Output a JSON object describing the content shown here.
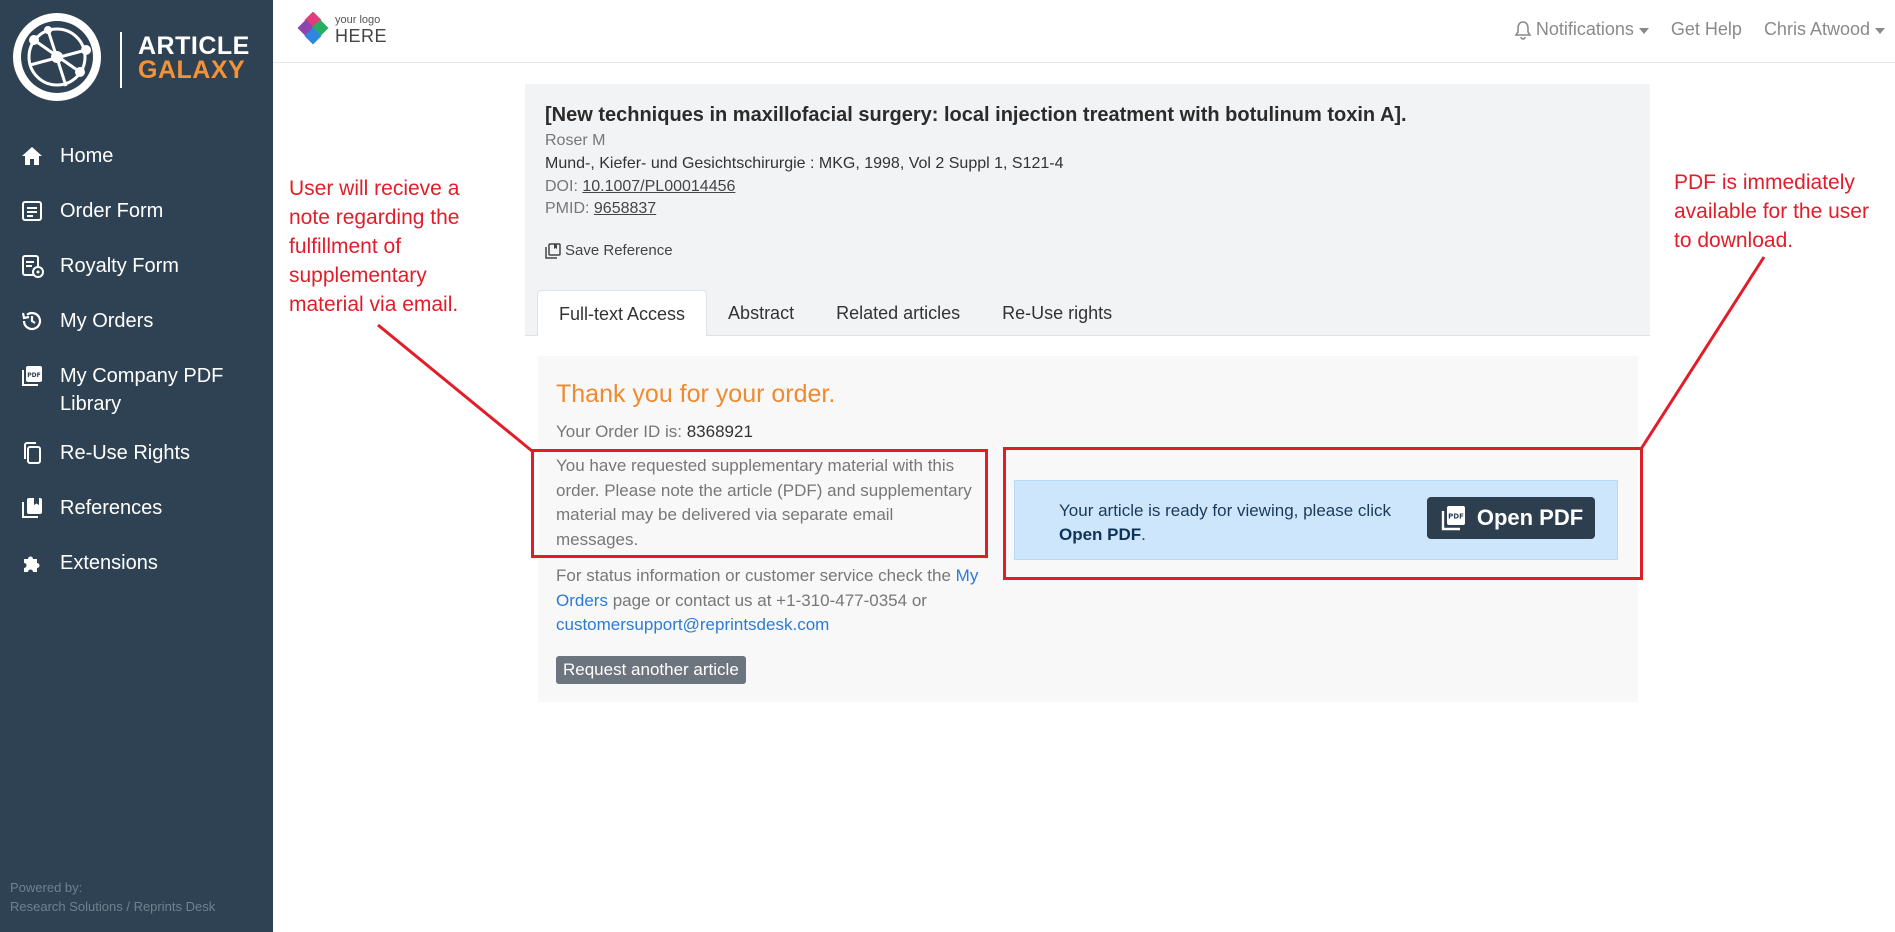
{
  "brand": {
    "line1": "ARTICLE",
    "line2": "GALAXY"
  },
  "sidebar": {
    "items": [
      {
        "label": "Home",
        "icon": "home-icon"
      },
      {
        "label": "Order Form",
        "icon": "order-form-icon"
      },
      {
        "label": "Royalty Form",
        "icon": "royalty-form-icon"
      },
      {
        "label": "My Orders",
        "icon": "history-icon"
      },
      {
        "label": "My Company PDF Library",
        "icon": "pdf-library-icon"
      },
      {
        "label": "Re-Use Rights",
        "icon": "copy-icon"
      },
      {
        "label": "References",
        "icon": "references-icon"
      },
      {
        "label": "Extensions",
        "icon": "puzzle-icon"
      }
    ],
    "powered_by": "Powered by:",
    "powered_company": "Research Solutions / Reprints Desk"
  },
  "topbar": {
    "logo_small": "your logo",
    "logo_large": "HERE",
    "notifications": "Notifications",
    "help": "Get Help",
    "user": "Chris Atwood"
  },
  "reference": {
    "title": "[New techniques in maxillofacial surgery: local injection treatment with botulinum toxin A].",
    "author": "Roser M",
    "journal": "Mund-, Kiefer- und Gesichtschirurgie : MKG, 1998, Vol 2 Suppl 1, S121-4",
    "doi_label": "DOI:",
    "doi": "10.1007/PL00014456",
    "pmid_label": "PMID:",
    "pmid": "9658837",
    "save_label": "Save Reference"
  },
  "tabs": [
    "Full-text Access",
    "Abstract",
    "Related articles",
    "Re-Use rights"
  ],
  "order": {
    "thanks": "Thank you for your order.",
    "id_label": "Your Order ID is:",
    "id": "8368921",
    "supplementary_note": "You have requested supplementary material with this order. Please note the article (PDF) and supplementary material may be delivered via separate email messages.",
    "status_pre": "For status information or customer service check the ",
    "status_link": "My Orders",
    "status_mid": " page or contact us at +1-310-477-0354 or ",
    "email": "customersupport@reprintsdesk.com",
    "request_button": "Request another article",
    "ready_pre": "Your article is ready for viewing, please click ",
    "ready_bold": "Open PDF",
    "ready_post": ".",
    "pdf_button": "Open PDF"
  },
  "annotations": {
    "left": "User will recieve a note regarding the fulfillment of supplementary material via email.",
    "right": "PDF is immediately available for the user to download."
  },
  "colors": {
    "sidebar_bg": "#2e4253",
    "brand_accent": "#f39237",
    "thanks": "#f08a2e",
    "link": "#2d7ad6",
    "annotation": "#e21d2a",
    "ready_bg": "#cde6fb",
    "pdf_button_bg": "#2d3e4e"
  }
}
